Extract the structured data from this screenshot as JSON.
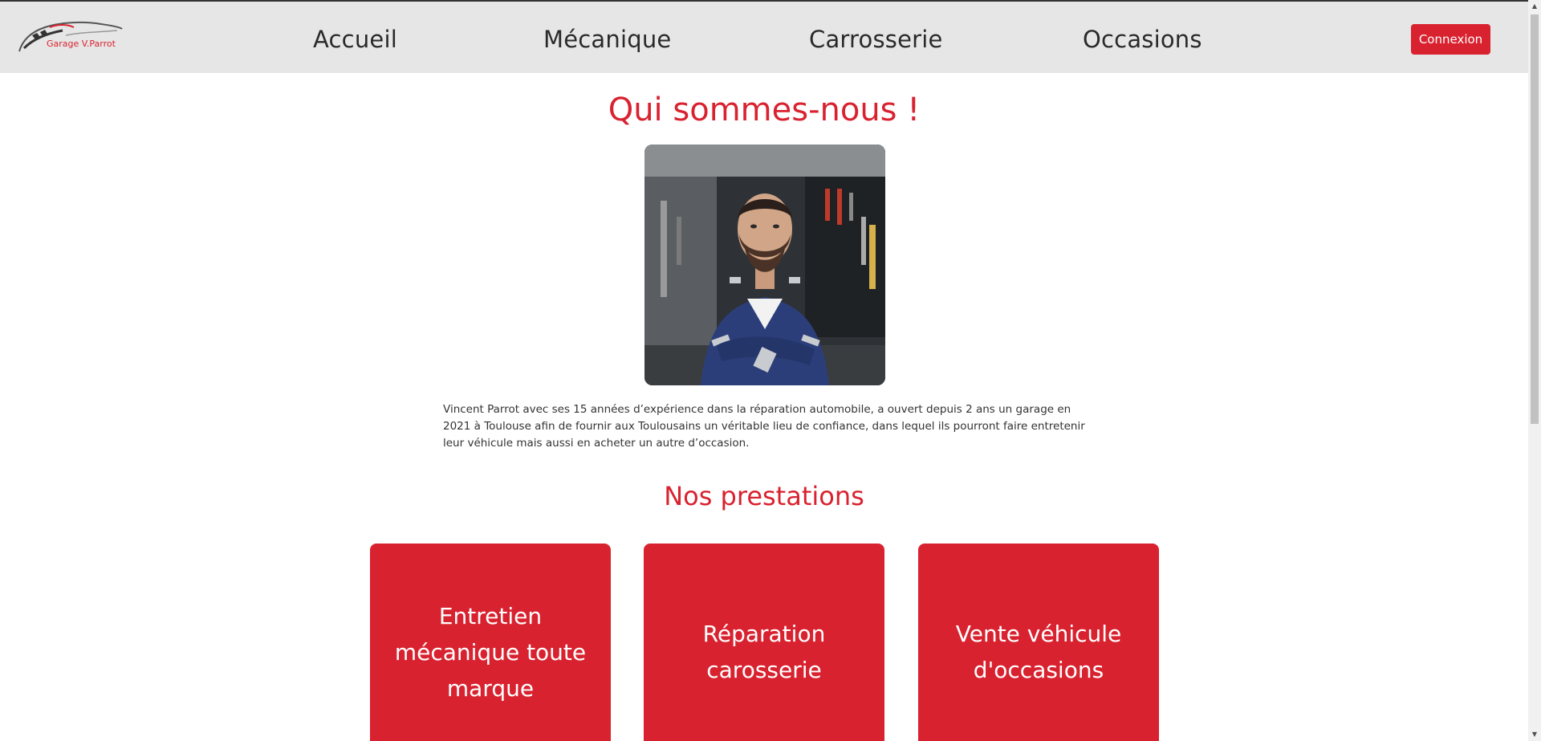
{
  "brand": {
    "logo_text": "Garage V.Parrot",
    "accent_color": "#d9222f"
  },
  "nav": {
    "items": [
      "Accueil",
      "Mécanique",
      "Carrosserie",
      "Occasions"
    ],
    "login_label": "Connexion"
  },
  "about": {
    "title": "Qui sommes-nous !",
    "portrait_icon": "mechanic-portrait",
    "text": "Vincent Parrot avec ses 15 années d’expérience dans la réparation automobile, a ouvert depuis 2 ans un garage en 2021 à Toulouse afin de fournir aux Toulousains un véritable lieu de confiance, dans lequel ils pourront faire entretenir leur véhicule mais aussi en acheter un autre d’occasion."
  },
  "services": {
    "title": "Nos prestations",
    "cards": [
      "Entretien mécanique toute marque",
      "Réparation carosserie",
      "Vente véhicule d'occasions"
    ]
  }
}
